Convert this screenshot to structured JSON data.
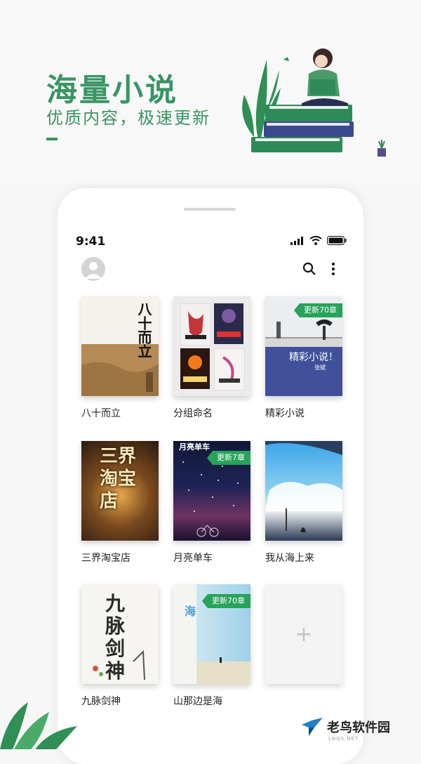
{
  "promo": {
    "title": "海量小说",
    "subtitle": "优质内容，极速更新"
  },
  "status_bar": {
    "time": "9:41"
  },
  "header": {
    "avatar_icon": "user-avatar-icon",
    "search_icon": "search-icon",
    "more_icon": "more-vertical-icon"
  },
  "books": [
    {
      "title": "八十而立",
      "cover_text": "八十而立",
      "badge": ""
    },
    {
      "title": "分组命名",
      "cover_text": "",
      "badge": ""
    },
    {
      "title": "精彩小说",
      "cover_text": "精彩小说！",
      "cover_author": "张斌",
      "badge": "更新70章"
    },
    {
      "title": "三界淘宝店",
      "cover_text": "三界淘宝店",
      "badge": ""
    },
    {
      "title": "月亮单车",
      "cover_text": "月亮单车",
      "badge": "更新7章"
    },
    {
      "title": "我从海上来",
      "cover_text": "",
      "badge": ""
    },
    {
      "title": "九脉剑神",
      "cover_text": "九脉剑神",
      "badge": ""
    },
    {
      "title": "山那边是海",
      "cover_text": "海",
      "badge": "更新70章"
    }
  ],
  "add_card": {
    "symbol": "+"
  },
  "watermark": {
    "text": "老鸟软件园",
    "sub": "LNQS.NET"
  },
  "colors": {
    "brand_green": "#3a9464",
    "badge_green": "#27a35a"
  }
}
